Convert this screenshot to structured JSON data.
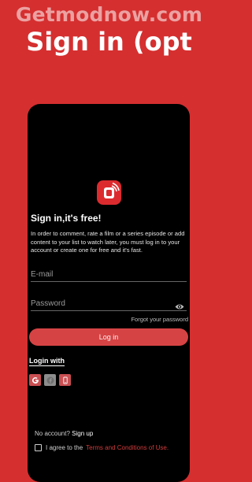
{
  "overlay": {
    "watermark": "Getmodnow.com",
    "headline": "Sign in (opt"
  },
  "app": {
    "title": "Sign in,it's free!",
    "description": "In order to comment, rate a film or a series episode or add content to your list to watch later, you must log in to your account or create one for free and it's fast.",
    "email_placeholder": "E-mail",
    "password_placeholder": "Password",
    "forgot_password": "Forgot your password",
    "login_button": "Log in",
    "login_with": "Login with",
    "social_icons": [
      "google-icon",
      "facebook-icon",
      "phone-icon"
    ],
    "no_account": "No account?",
    "signup_link": "Sign up",
    "agree_prefix": "I agree to the",
    "terms_link": "Terms and Conditions of Use."
  },
  "colors": {
    "background": "#d52f30",
    "accent": "#d64344",
    "screen": "#000000"
  }
}
